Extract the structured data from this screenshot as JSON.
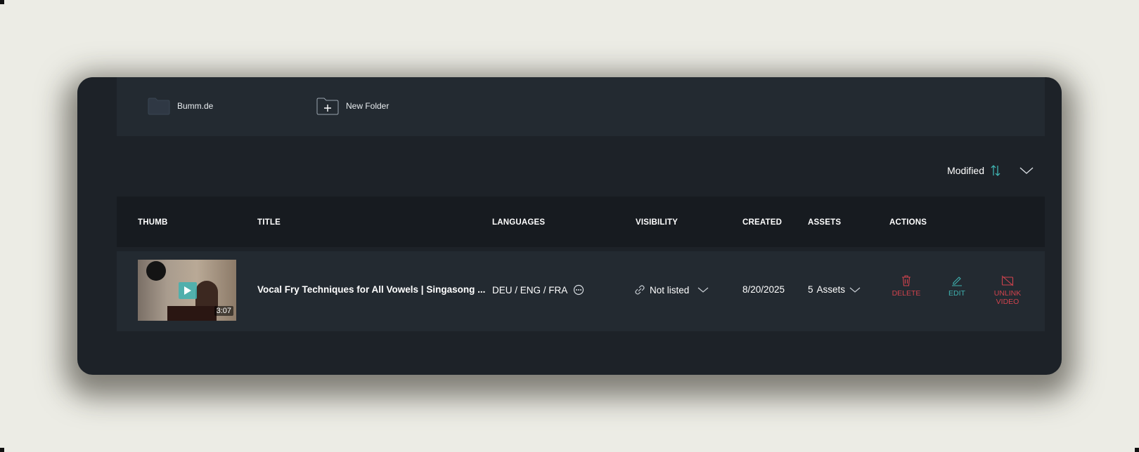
{
  "folders": [
    {
      "label": "Bumm.de"
    },
    {
      "label": "New Folder"
    }
  ],
  "sort": {
    "label": "Modified"
  },
  "table": {
    "headers": [
      "THUMB",
      "TITLE",
      "LANGUAGES",
      "VISIBILITY",
      "CREATED",
      "ASSETS",
      "ACTIONS"
    ],
    "rows": [
      {
        "duration": "3:07",
        "title": "Vocal Fry Techniques for All Vowels | Singasong ...",
        "languages": "DEU / ENG / FRA",
        "visibility": "Not listed",
        "created": "8/20/2025",
        "assets_count": "5",
        "assets_label": "Assets",
        "actions": {
          "delete": "DELETE",
          "edit": "EDIT",
          "unlink_line1": "UNLINK",
          "unlink_line2": "VIDEO"
        }
      }
    ]
  },
  "colors": {
    "accent": "#3fb2b0",
    "danger": "#d0434d",
    "panel": "#1d2228"
  }
}
